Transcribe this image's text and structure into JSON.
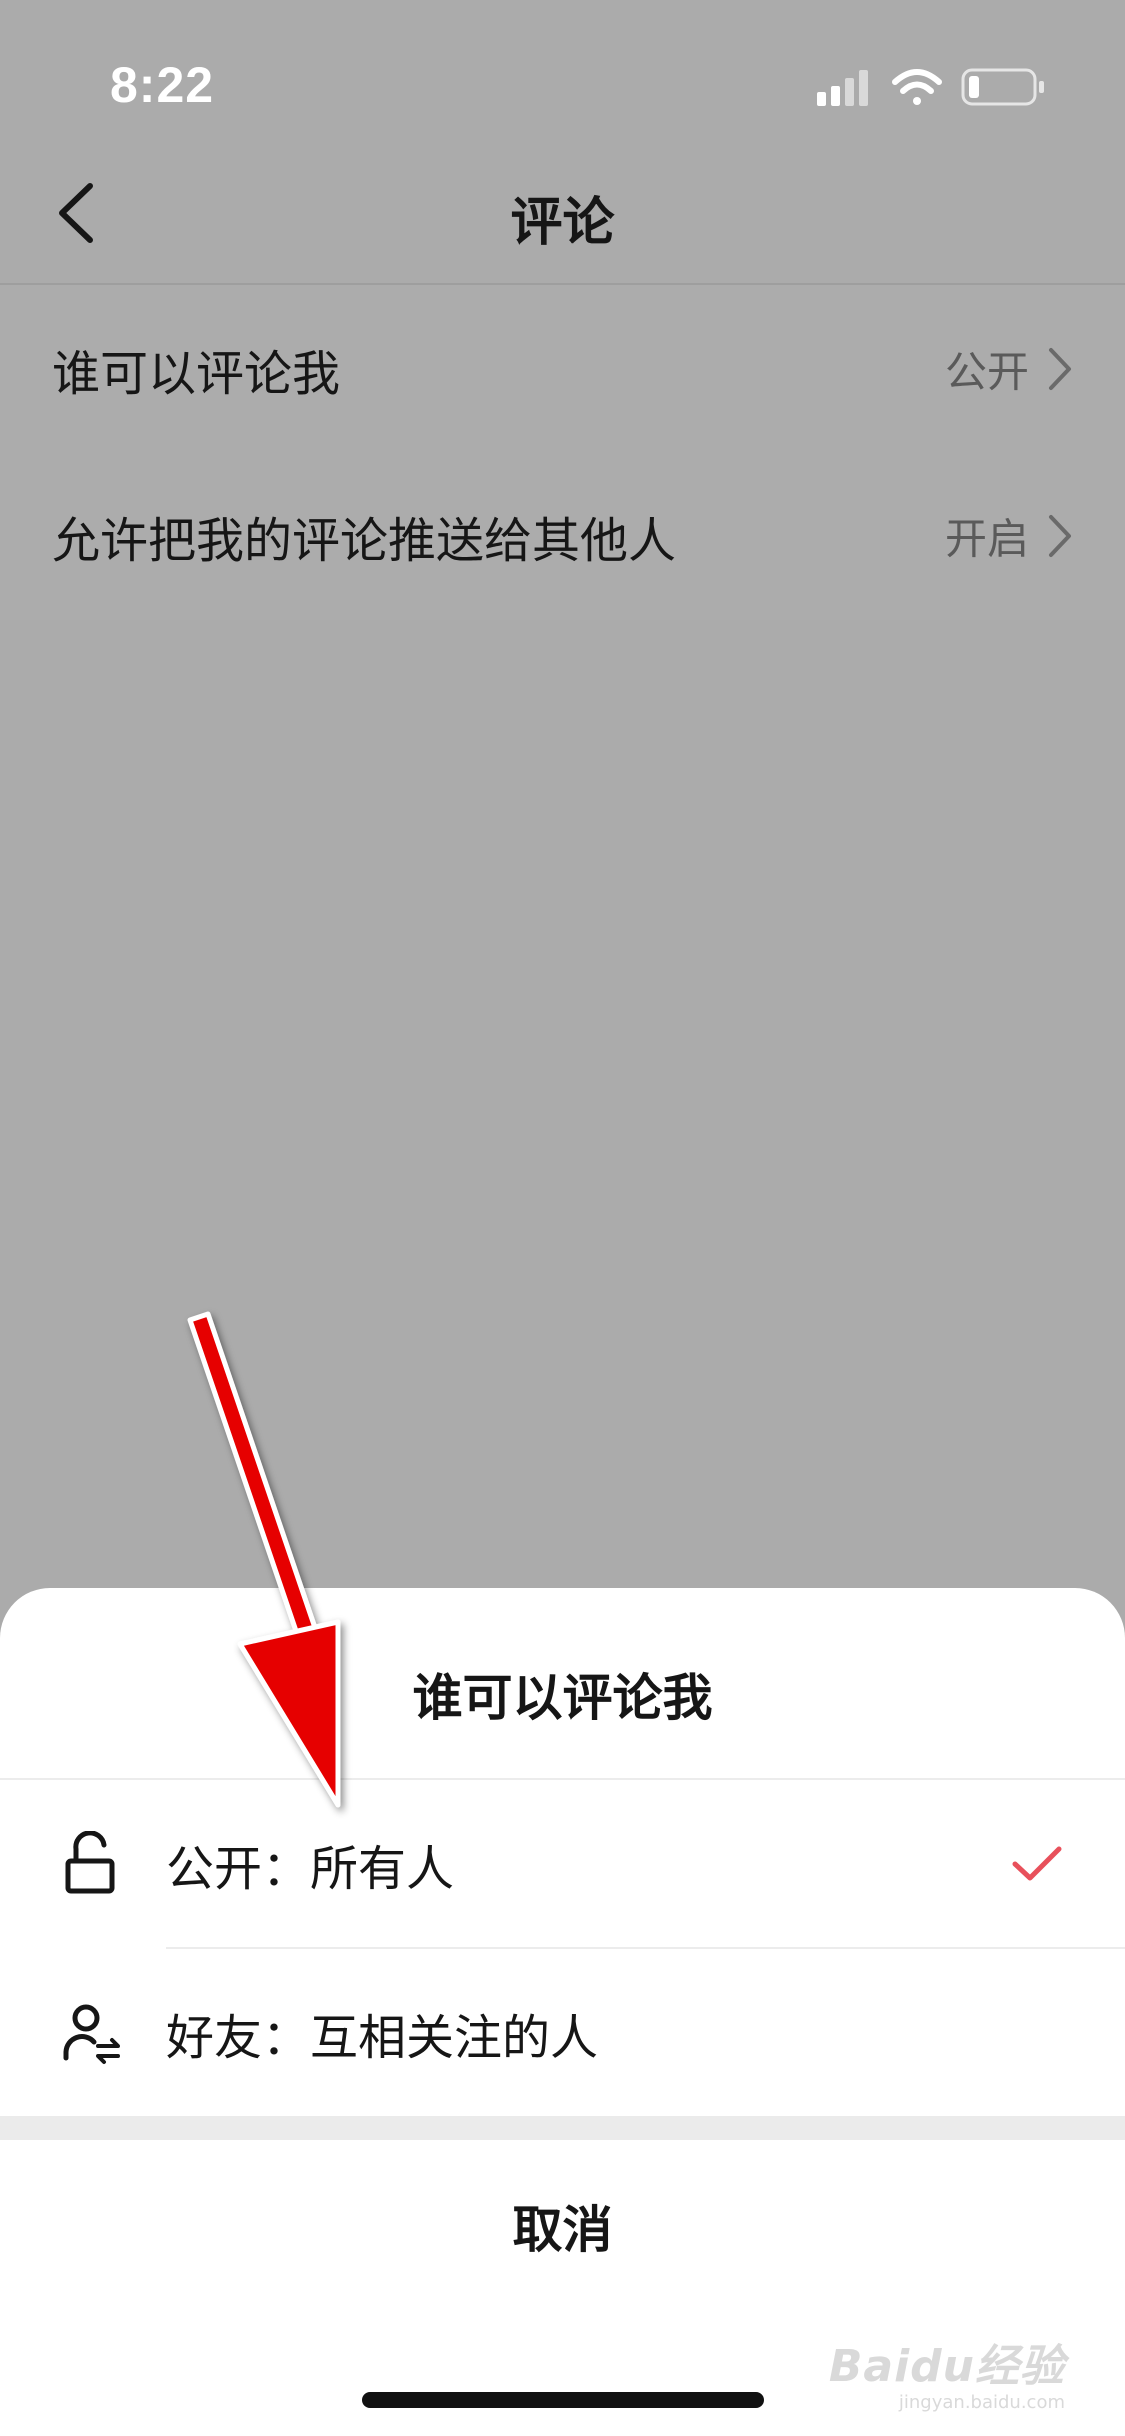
{
  "status_bar": {
    "time": "8:22"
  },
  "nav": {
    "title": "评论"
  },
  "settings": [
    {
      "label": "谁可以评论我",
      "value": "公开"
    },
    {
      "label": "允许把我的评论推送给其他人",
      "value": "开启"
    }
  ],
  "sheet": {
    "title": "谁可以评论我",
    "options": [
      {
        "icon": "unlock-icon",
        "label": "公开：所有人",
        "selected": true
      },
      {
        "icon": "mutual-follow-user-icon",
        "label": "好友：互相关注的人",
        "selected": false
      }
    ],
    "cancel_label": "取消"
  },
  "watermark": {
    "main": "Baidu经验",
    "sub": "jingyan.baidu.com"
  },
  "colors": {
    "overlay": "#ababab",
    "check": "#e8505b",
    "arrow": "#e60000"
  }
}
